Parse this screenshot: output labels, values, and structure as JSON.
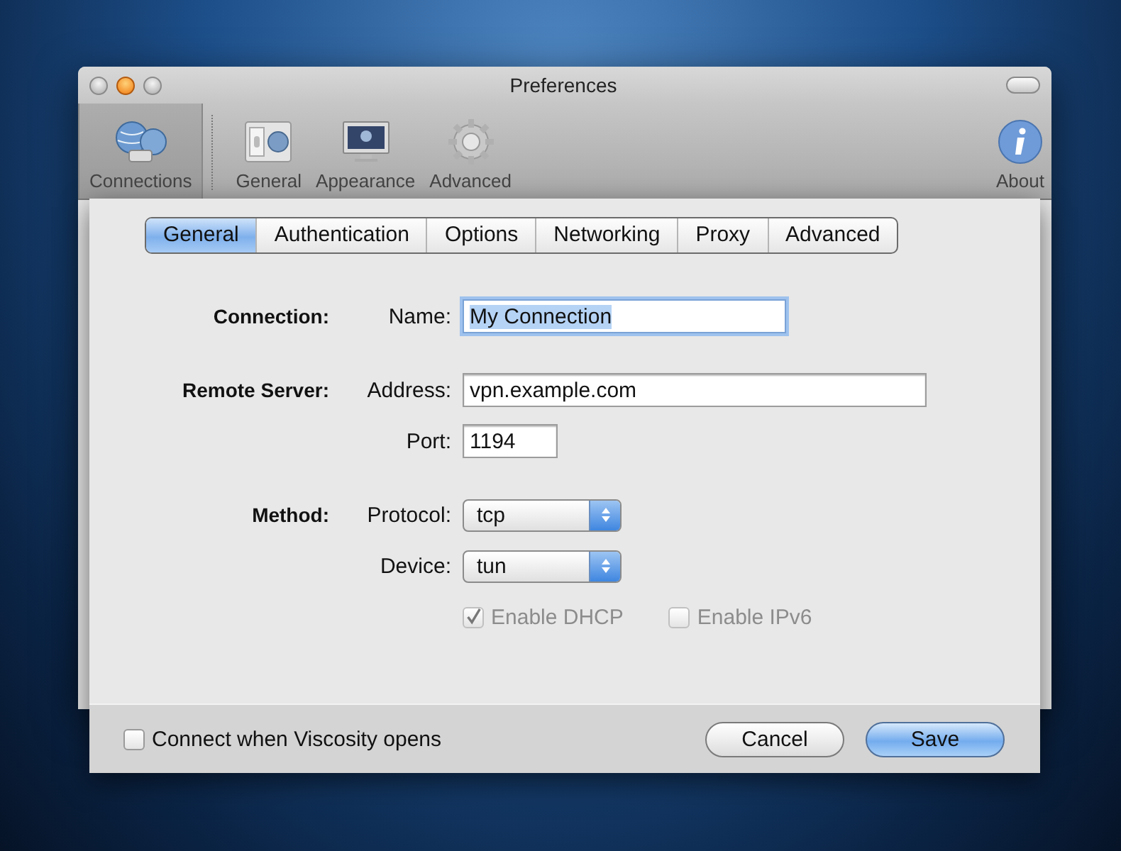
{
  "window": {
    "title": "Preferences"
  },
  "toolbar": {
    "items": [
      {
        "label": "Connections",
        "selected": true
      },
      {
        "label": "General",
        "selected": false
      },
      {
        "label": "Appearance",
        "selected": false
      },
      {
        "label": "Advanced",
        "selected": false
      }
    ],
    "about": {
      "label": "About",
      "selected": false
    }
  },
  "sheet": {
    "tabs": [
      {
        "label": "General",
        "selected": true
      },
      {
        "label": "Authentication",
        "selected": false
      },
      {
        "label": "Options",
        "selected": false
      },
      {
        "label": "Networking",
        "selected": false
      },
      {
        "label": "Proxy",
        "selected": false
      },
      {
        "label": "Advanced",
        "selected": false
      }
    ],
    "sections": [
      {
        "heading": "Connection:",
        "rows": [
          {
            "kind": "text",
            "label": "Name:",
            "value": "My Connection",
            "focused": true
          }
        ]
      },
      {
        "heading": "Remote Server:",
        "rows": [
          {
            "kind": "text",
            "label": "Address:",
            "value": "vpn.example.com",
            "focused": false
          },
          {
            "kind": "text",
            "label": "Port:",
            "value": "1194",
            "focused": false
          }
        ]
      },
      {
        "heading": "Method:",
        "rows": [
          {
            "kind": "popup",
            "label": "Protocol:",
            "value": "tcp"
          },
          {
            "kind": "popup",
            "label": "Device:",
            "value": "tun"
          },
          {
            "kind": "checks",
            "items": [
              {
                "label": "Enable DHCP",
                "checked": true,
                "disabled": true
              },
              {
                "label": "Enable IPv6",
                "checked": false,
                "disabled": true
              }
            ]
          }
        ]
      }
    ],
    "footer": {
      "checkbox": {
        "label": "Connect when Viscosity opens",
        "checked": false
      },
      "buttons": [
        {
          "label": "Cancel",
          "default": false
        },
        {
          "label": "Save",
          "default": true
        }
      ]
    }
  }
}
